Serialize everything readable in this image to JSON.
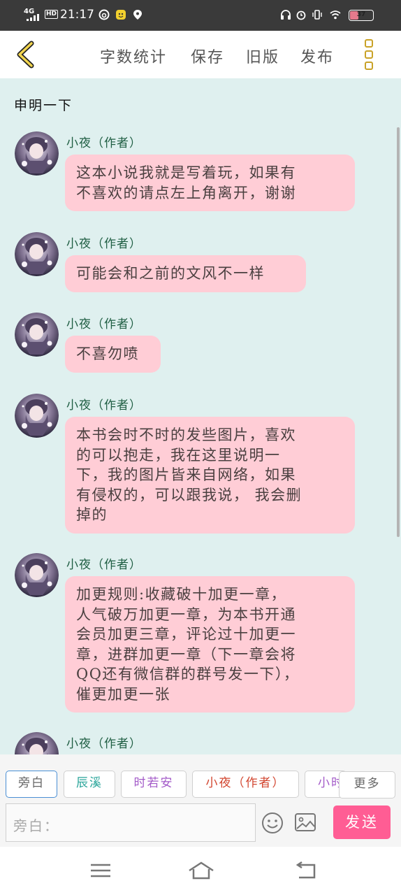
{
  "status_bar": {
    "network": "4G",
    "hd": "HD",
    "time": "21:17",
    "battery": "37",
    "battery_level": 0.37,
    "left_icons": [
      "netease-music-icon",
      "app-face-icon",
      "location-pin-icon"
    ],
    "right_icons": [
      "headphones-icon",
      "alarm-icon",
      "vibrate-icon",
      "wifi-icon",
      "battery-icon"
    ]
  },
  "toolbar": {
    "back_icon": "chevron-left-icon",
    "word_count": "字数统计",
    "save": "保存",
    "old_version": "旧版",
    "publish": "发布",
    "menu_icon": "more-vertical-icon",
    "accent_color": "#c9a227"
  },
  "chat": {
    "statement": "申明一下",
    "background": "#dff0ef",
    "bubble_color": "#ffcdd6",
    "messages": [
      {
        "name": "小夜（作者）",
        "lines": [
          "这本小说我就是写着玩，如果有",
          "不喜欢的请点左上角离开，谢谢"
        ]
      },
      {
        "name": "小夜（作者）",
        "lines": [
          "可能会和之前的文风不一样"
        ]
      },
      {
        "name": "小夜（作者）",
        "lines": [
          "不喜勿喷"
        ]
      },
      {
        "name": "小夜（作者）",
        "lines": [
          "本书会时不时的发些图片，喜欢",
          "的可以抱走，我在这里说明一",
          "下，我的图片皆来自网络，如果",
          "有侵权的，可以跟我说， 我会删",
          "掉的"
        ]
      },
      {
        "name": "小夜（作者）",
        "lines": [
          "加更规则:收藏破十加更一章，",
          "人气破万加更一章，为本书开通",
          "会员加更三章，评论过十加更一",
          "章，进群加更一章（下一章会将",
          "QQ还有微信群的群号发一下），",
          "催更加更一张"
        ]
      },
      {
        "name": "小夜（作者）",
        "lines": []
      }
    ]
  },
  "speakers": {
    "items": [
      {
        "label": "旁白",
        "color": "#666666",
        "selected": true
      },
      {
        "label": "辰溪",
        "color": "#2aa59a",
        "selected": false
      },
      {
        "label": "时若安",
        "color": "#a35ac8",
        "selected": false
      },
      {
        "label": "小夜（作者）",
        "color": "#d2452f",
        "selected": false
      },
      {
        "label": "小时",
        "color": "#a35ac8",
        "selected": false
      }
    ],
    "more": "更多"
  },
  "composer": {
    "placeholder": "旁白：",
    "emoji_icon": "smiley-icon",
    "image_icon": "image-icon",
    "send": "发送",
    "send_color": "#ff5d94"
  },
  "nav_bar": {
    "menu_icon": "menu-icon",
    "home_icon": "home-icon",
    "back_icon": "back-icon"
  }
}
